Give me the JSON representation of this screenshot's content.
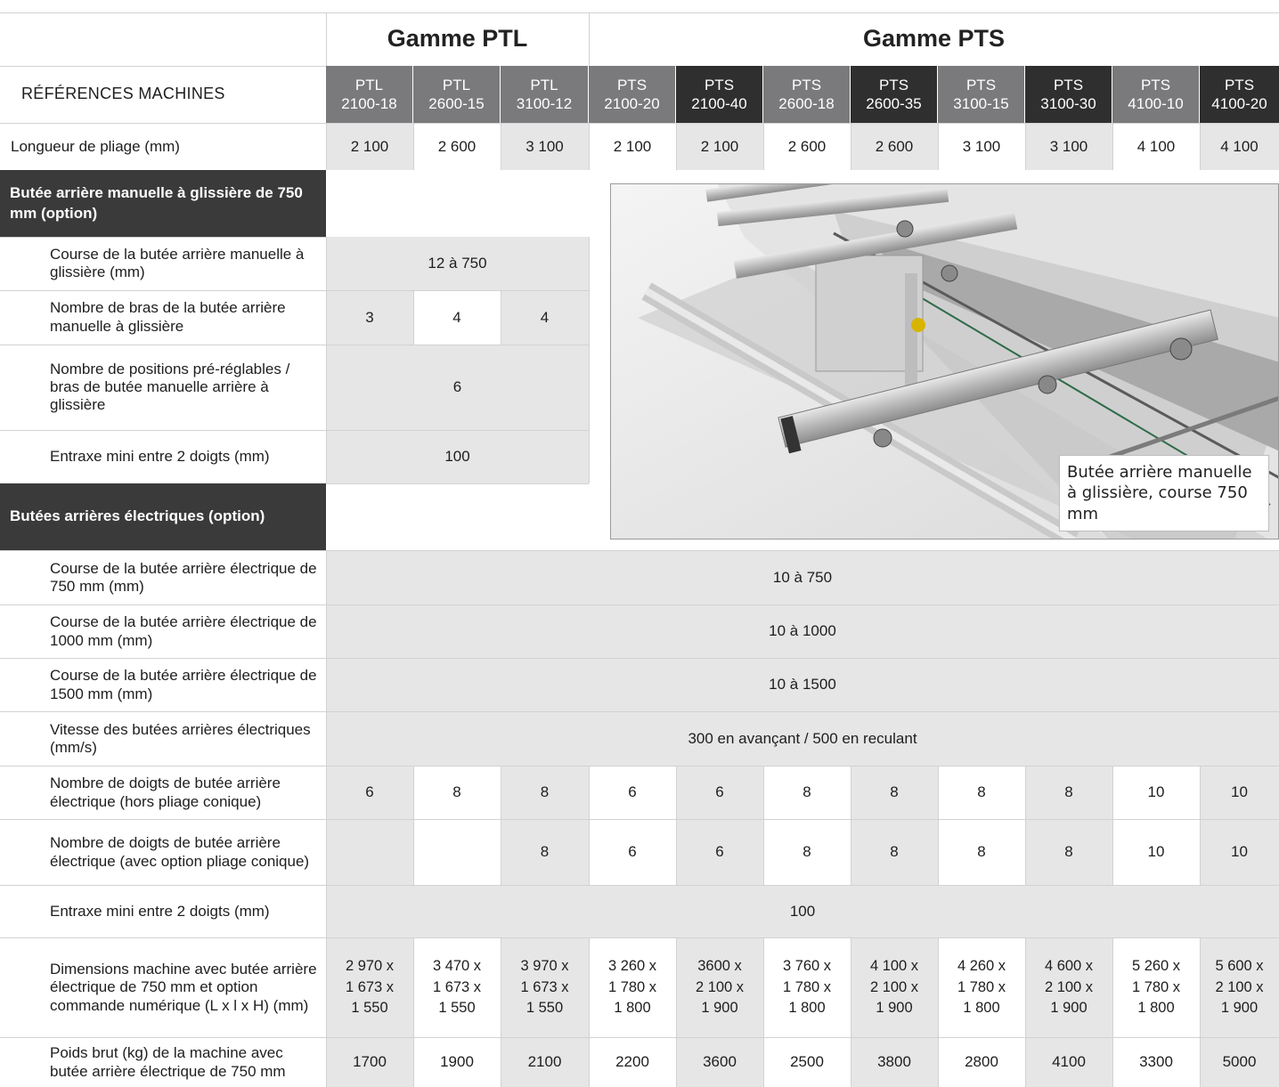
{
  "header": {
    "range_ptl": "Gamme PTL",
    "range_pts": "Gamme PTS",
    "references_label": "RÉFÉRENCES MACHINES",
    "models": [
      {
        "line1": "PTL",
        "line2": "2100-18"
      },
      {
        "line1": "PTL",
        "line2": "2600-15"
      },
      {
        "line1": "PTL",
        "line2": "3100-12"
      },
      {
        "line1": "PTS",
        "line2": "2100-20"
      },
      {
        "line1": "PTS",
        "line2": "2100-40"
      },
      {
        "line1": "PTS",
        "line2": "2600-18"
      },
      {
        "line1": "PTS",
        "line2": "2600-35"
      },
      {
        "line1": "PTS",
        "line2": "3100-15"
      },
      {
        "line1": "PTS",
        "line2": "3100-30"
      },
      {
        "line1": "PTS",
        "line2": "4100-10"
      },
      {
        "line1": "PTS",
        "line2": "4100-20"
      }
    ]
  },
  "bending_length": {
    "label": "Longueur de pliage (mm)",
    "values": [
      "2 100",
      "2 600",
      "3 100",
      "2 100",
      "2 100",
      "2 600",
      "2 600",
      "3 100",
      "3 100",
      "4 100",
      "4 100"
    ]
  },
  "manual_backgauge": {
    "title": "Butée arrière manuelle à glissière de 750 mm (option)",
    "stroke": {
      "label": "Course de la butée arrière manuelle à glissière (mm)",
      "value": "12 à 750"
    },
    "arms": {
      "label": "Nombre de bras de la butée arrière manuelle à glissière",
      "values": [
        "3",
        "4",
        "4"
      ]
    },
    "positions": {
      "label": "Nombre de positions pré-réglables / bras de butée manuelle arrière à glissière",
      "value": "6"
    },
    "spacing": {
      "label": "Entraxe mini entre 2 doigts (mm)",
      "value": "100"
    }
  },
  "photo": {
    "caption": "Butée arrière manuelle à glissière, course 750 mm"
  },
  "electric_backgauge": {
    "title": "Butées arrières électriques (option)",
    "stroke_750": {
      "label": "Course de la butée arrière électrique de 750 mm (mm)",
      "value": "10 à 750"
    },
    "stroke_1000": {
      "label": "Course de la butée arrière électrique de 1000 mm (mm)",
      "value": "10 à 1000"
    },
    "stroke_1500": {
      "label": "Course de la butée arrière électrique de 1500 mm (mm)",
      "value": "10 à 1500"
    },
    "speed": {
      "label": "Vitesse des butées arrières électriques (mm/s)",
      "value": "300 en avançant / 500 en reculant"
    },
    "fingers_std": {
      "label": "Nombre de doigts de butée arrière électrique (hors pliage conique)",
      "values": [
        "6",
        "8",
        "8",
        "6",
        "6",
        "8",
        "8",
        "8",
        "8",
        "10",
        "10"
      ]
    },
    "fingers_conic": {
      "label": "Nombre de doigts de butée arrière électrique (avec option pliage conique)",
      "values": [
        "",
        "",
        "8",
        "6",
        "6",
        "8",
        "8",
        "8",
        "8",
        "10",
        "10"
      ]
    },
    "spacing": {
      "label": "Entraxe mini entre 2 doigts (mm)",
      "value": "100"
    },
    "dimensions": {
      "label": "Dimensions machine avec butée arrière électrique de 750 mm et option commande numérique (L x l x H) (mm)",
      "values": [
        [
          "2 970 x",
          "1 673 x",
          "1 550"
        ],
        [
          "3 470 x",
          "1 673 x",
          "1 550"
        ],
        [
          "3 970 x",
          "1 673 x",
          "1 550"
        ],
        [
          "3 260 x",
          "1 780 x",
          "1 800"
        ],
        [
          "3600 x",
          "2 100 x",
          "1 900"
        ],
        [
          "3 760 x",
          "1 780 x",
          "1 800"
        ],
        [
          "4 100 x",
          "2 100 x",
          "1 900"
        ],
        [
          "4 260 x",
          "1 780 x",
          "1 800"
        ],
        [
          "4 600 x",
          "2 100 x",
          "1 900"
        ],
        [
          "5 260 x",
          "1 780 x",
          "1 800"
        ],
        [
          "5 600 x",
          "2 100 x",
          "1 900"
        ]
      ]
    },
    "weight": {
      "label": "Poids brut (kg) de la machine avec butée arrière électrique de 750 mm",
      "values": [
        "1700",
        "1900",
        "2100",
        "2200",
        "3600",
        "2500",
        "3800",
        "2800",
        "4100",
        "3300",
        "5000"
      ]
    }
  }
}
